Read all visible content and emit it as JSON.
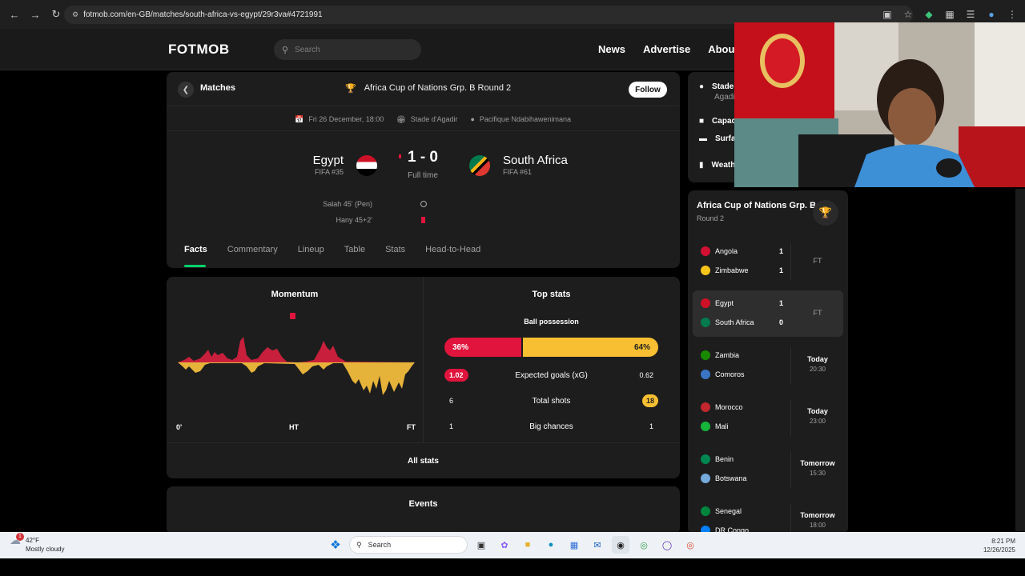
{
  "browser": {
    "url": "fotmob.com/en-GB/matches/south-africa-vs-egypt/29r3va#4721991"
  },
  "site": {
    "logo": "FOTMOB",
    "search_placeholder": "Search",
    "nav": [
      "News",
      "Advertise",
      "Abou"
    ]
  },
  "match": {
    "back_label": "Matches",
    "competition": "Africa Cup of Nations Grp. B Round 2",
    "follow_label": "Follow",
    "date": "Fri 26 December, 18:00",
    "venue": "Stade d'Agadir",
    "referee": "Pacifique Ndabihawenimana",
    "home": {
      "name": "Egypt",
      "rank": "FIFA #35"
    },
    "away": {
      "name": "South Africa",
      "rank": "FIFA #61"
    },
    "score": "1 - 0",
    "status": "Full time",
    "events": [
      {
        "text": "Salah 45' (Pen)",
        "type": "goal"
      },
      {
        "text": "Hany 45+2'",
        "type": "red-card"
      }
    ],
    "tabs": [
      "Facts",
      "Commentary",
      "Lineup",
      "Table",
      "Stats",
      "Head-to-Head"
    ],
    "active_tab": "Facts"
  },
  "momentum": {
    "title": "Momentum",
    "axis": [
      "0'",
      "HT",
      "FT"
    ]
  },
  "top_stats": {
    "title": "Top stats",
    "possession_label": "Ball possession",
    "possession_home": "36%",
    "possession_away": "64%",
    "possession_home_value": 36,
    "rows": [
      {
        "label": "Expected goals (xG)",
        "home": "1.02",
        "away": "0.62",
        "highlight": "home"
      },
      {
        "label": "Total shots",
        "home": "6",
        "away": "18",
        "highlight": "away"
      },
      {
        "label": "Big chances",
        "home": "1",
        "away": "1",
        "highlight": "none"
      }
    ],
    "all_stats_label": "All stats"
  },
  "events_section": {
    "title": "Events"
  },
  "venue_panel": {
    "items": [
      "Stade",
      "Agadi",
      "Capac",
      "Surfac",
      "Weath"
    ]
  },
  "league": {
    "title": "Africa Cup of Nations Grp. B",
    "round": "Round 2",
    "fixtures": [
      {
        "home": "Angola",
        "away": "Zimbabwe",
        "home_score": "1",
        "away_score": "1",
        "status": "FT",
        "day": "",
        "time": "",
        "home_color": "#d21034",
        "away_color": "#f5c518"
      },
      {
        "home": "Egypt",
        "away": "South Africa",
        "home_score": "1",
        "away_score": "0",
        "status": "FT",
        "day": "",
        "time": "",
        "home_color": "#ce1126",
        "away_color": "#007a4d"
      },
      {
        "home": "Zambia",
        "away": "Comoros",
        "home_score": "",
        "away_score": "",
        "status": "",
        "day": "Today",
        "time": "20:30",
        "home_color": "#198a00",
        "away_color": "#3a75c4"
      },
      {
        "home": "Morocco",
        "away": "Mali",
        "home_score": "",
        "away_score": "",
        "status": "",
        "day": "Today",
        "time": "23:00",
        "home_color": "#c1272d",
        "away_color": "#14b53a"
      },
      {
        "home": "Benin",
        "away": "Botswana",
        "home_score": "",
        "away_score": "",
        "status": "",
        "day": "Tomorrow",
        "time": "15:30",
        "home_color": "#008751",
        "away_color": "#75aadb"
      },
      {
        "home": "Senegal",
        "away": "DR Congo",
        "home_score": "",
        "away_score": "",
        "status": "",
        "day": "Tomorrow",
        "time": "18:00",
        "home_color": "#00853f",
        "away_color": "#007fff"
      }
    ]
  },
  "taskbar": {
    "temp": "42°F",
    "weather": "Mostly cloudy",
    "search": "Search",
    "time": "8:21 PM",
    "date": "12/26/2025",
    "badge": "1"
  },
  "colors": {
    "home": "#e0143c",
    "away": "#f7bf31",
    "accent": "#00d26a"
  }
}
